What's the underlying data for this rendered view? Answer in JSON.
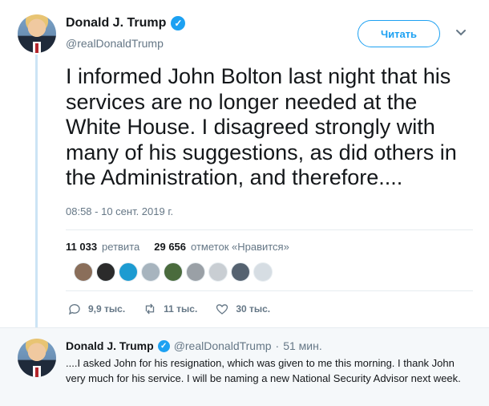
{
  "tweet": {
    "author_name": "Donald J. Trump",
    "handle": "@realDonaldTrump",
    "follow_label": "Читать",
    "text": "I informed John Bolton last night that his services are no longer needed at the White House. I disagreed strongly with many of his suggestions, as did others in the Administration, and therefore....",
    "timestamp": "08:58 - 10 сент. 2019 г.",
    "retweets_count": "11 033",
    "retweets_label": "ретвита",
    "likes_count": "29 656",
    "likes_label": "отметок «Нравится»",
    "liker_avatar_colors": [
      "#8a6e5a",
      "#2b2b2b",
      "#1d9bd1",
      "#a7b4be",
      "#4a6b3d",
      "#9aa0a6",
      "#c9ced3",
      "#556270",
      "#d6dde3"
    ],
    "actions": {
      "reply_count": "9,9 тыс.",
      "retweet_count": "11 тыс.",
      "like_count": "30 тыс."
    }
  },
  "reply": {
    "author_name": "Donald J. Trump",
    "handle": "@realDonaldTrump",
    "separator": "·",
    "time": "51 мин.",
    "text": "....I asked John for his resignation, which was given to me this morning. I thank John very much for his service. I will be naming a new National Security Advisor next week."
  },
  "colors": {
    "accent": "#1da1f2",
    "secondary_text": "#657786",
    "thread_line": "#cce4f5"
  }
}
